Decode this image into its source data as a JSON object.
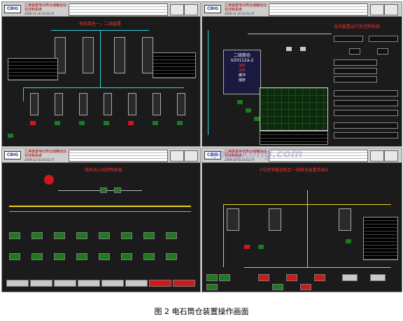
{
  "screens": [
    {
      "title": "电石筒仓一、二线装置",
      "header": {
        "logo": "CBIG",
        "company": "乙烯装置电石筒仓储罐自动化控制系统",
        "datetime": "2009-11-10 16:52:37"
      }
    },
    {
      "title": "仓内装置运行及控制系统",
      "header": {
        "logo": "CBIG",
        "company": "乙烯装置电石筒仓储罐自动化控制系统",
        "datetime": "2009-11-10 16:52:37"
      },
      "silo": {
        "line": "二线筒仓",
        "id": "V20112a-2",
        "status1": "加料",
        "status2": "出料",
        "status3": "缓冲",
        "status4": "储存"
      }
    },
    {
      "title": "电石出入线控制系统",
      "header": {
        "logo": "CBIG",
        "company": "乙烯装置电石筒仓储罐自动化控制系统",
        "datetime": "2009-11-10 16:52:37"
      }
    },
    {
      "title": "2号皮带输送机至一线筒仓装置系统A",
      "header": {
        "logo": "CBIG",
        "company": "乙烯装置电石筒仓储罐自动化控制系统",
        "datetime": "2009-11-10 16:52:37"
      }
    }
  ],
  "watermark": "gongkong.com",
  "caption": "图 2  电石筒仓装置操作画面",
  "colors": {
    "run": "#1e7a1e",
    "alarm": "#d01818",
    "pipe": "#2ad6e0",
    "belt": "#e8d020"
  }
}
